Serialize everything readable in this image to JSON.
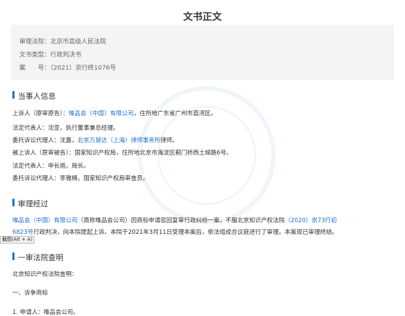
{
  "document": {
    "title": "文书正文"
  },
  "meta": {
    "court_label": "审理法院：",
    "court_value": "北京市高级人民法院",
    "doc_type_label": "文书类型：",
    "doc_type_value": "行政判决书",
    "case_no_label": "案　　号：",
    "case_no_value": "（2021）京行终1076号"
  },
  "parties": {
    "heading": "当事人信息",
    "appellant_prefix": "上诉人（原审原告）：",
    "appellant_name": "唯品会（中国）有限公司",
    "appellant_suffix": "，住所地广东省广州市荔湾区。",
    "legal_rep_1": "法定代表人：沈亚，执行董事兼总经理。",
    "agent_1_prefix": "委托诉讼代理人：沈嘉，",
    "agent_1_firm": "北京万慧达（上海）律师事务所",
    "agent_1_suffix": "律师。",
    "appellee": "被上诉人（原审被告）：国家知识产权局，住所地北京市海淀区蓟门桥西土城路6号。",
    "legal_rep_2": "法定代表人：申长雨，局长。",
    "agent_2": "委托诉讼代理人：李雅楠，国家知识产权局审查员。"
  },
  "trial": {
    "heading": "审理经过",
    "p1_link1": "唯品会（中国）有限公司",
    "p1_mid": "（简称唯品会公司）因商标申请驳回复审行政纠纷一案，不服北京知识产权法院",
    "p1_link2": "（2020）京73行初",
    "p2_link": "6823号",
    "p2_text": "行政判决，向本院提起上诉。本院于2021年3月11日受理本案后，依法组成合议庭进行了审理。本案现已审理终结。"
  },
  "first_instance": {
    "heading": "一审法院查明",
    "line1": "北京知识产权法院查明：",
    "line2": "一、诉争商标",
    "line3": "1. 申请人：唯品会公司。"
  },
  "tooltip": {
    "text": "截图(Alt + A)"
  }
}
